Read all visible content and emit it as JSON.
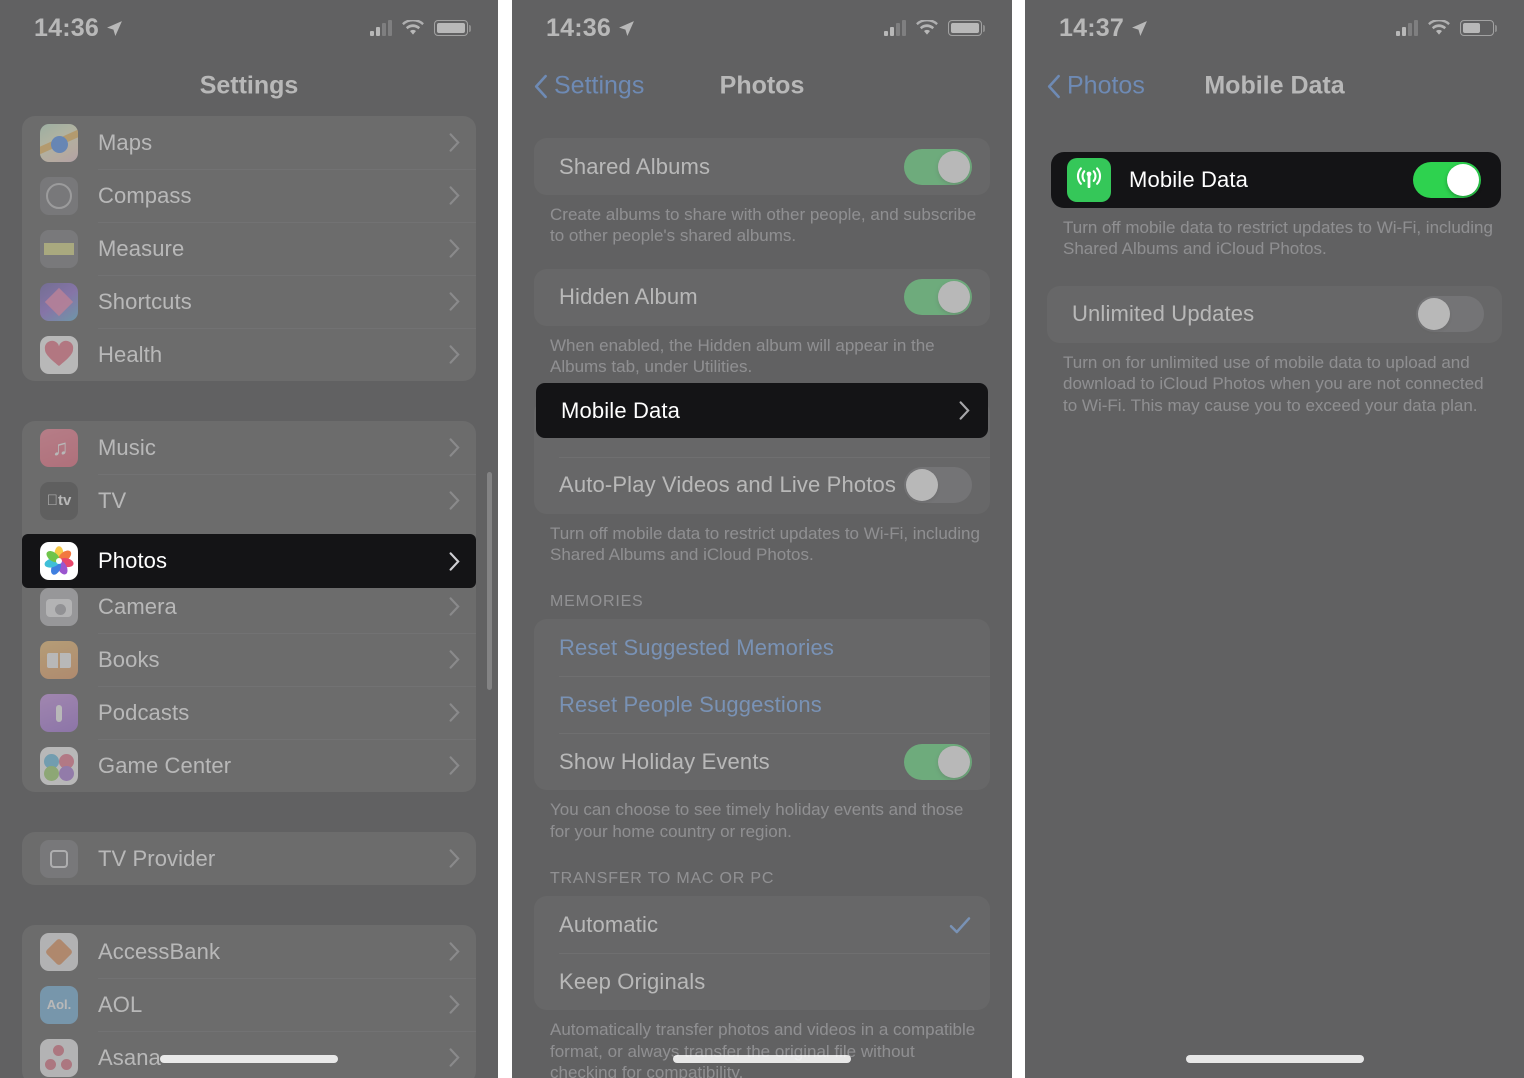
{
  "panels": [
    {
      "id": "settings-list",
      "status_bar": {
        "time": "14:36",
        "location_icon": "location-arrow-icon",
        "signal_icon": "cellular-bars-icon",
        "wifi_icon": "wifi-icon",
        "battery_icon": "battery-icon"
      },
      "nav": {
        "title": "Settings",
        "back_label": "",
        "has_back": false
      },
      "groups": [
        {
          "rows": [
            {
              "label": "Maps",
              "icon": "maps-app-icon",
              "chevron": true
            },
            {
              "label": "Compass",
              "icon": "compass-app-icon",
              "chevron": true
            },
            {
              "label": "Measure",
              "icon": "measure-app-icon",
              "chevron": true
            },
            {
              "label": "Shortcuts",
              "icon": "shortcuts-app-icon",
              "chevron": true
            },
            {
              "label": "Health",
              "icon": "health-app-icon",
              "chevron": true
            }
          ]
        },
        {
          "rows": [
            {
              "label": "Music",
              "icon": "music-app-icon",
              "chevron": true
            },
            {
              "label": "TV",
              "icon": "tv-app-icon",
              "chevron": true
            },
            {
              "label": "Photos",
              "icon": "photos-app-icon",
              "chevron": true,
              "highlighted": true
            },
            {
              "label": "Camera",
              "icon": "camera-app-icon",
              "chevron": true
            },
            {
              "label": "Books",
              "icon": "books-app-icon",
              "chevron": true
            },
            {
              "label": "Podcasts",
              "icon": "podcasts-app-icon",
              "chevron": true
            },
            {
              "label": "Game Center",
              "icon": "game-center-app-icon",
              "chevron": true
            }
          ]
        },
        {
          "rows": [
            {
              "label": "TV Provider",
              "icon": "tv-provider-icon",
              "chevron": true
            }
          ]
        },
        {
          "rows": [
            {
              "label": "AccessBank",
              "icon": "accessbank-app-icon",
              "chevron": true
            },
            {
              "label": "AOL",
              "icon": "aol-app-icon",
              "chevron": true
            },
            {
              "label": "Asana",
              "icon": "asana-app-icon",
              "chevron": true
            }
          ]
        }
      ]
    },
    {
      "id": "photos-settings",
      "status_bar": {
        "time": "14:36",
        "location_icon": "location-arrow-icon",
        "signal_icon": "cellular-bars-icon",
        "wifi_icon": "wifi-icon",
        "battery_icon": "battery-icon"
      },
      "nav": {
        "title": "Photos",
        "back_label": "Settings",
        "has_back": true
      },
      "sections": [
        {
          "header": "",
          "rows": [
            {
              "label": "Shared Albums",
              "control": "toggle",
              "value": "on"
            }
          ],
          "footnote": "Create albums to share with other people, and subscribe to other people's shared albums."
        },
        {
          "header": "",
          "rows": [
            {
              "label": "Hidden Album",
              "control": "toggle",
              "value": "on"
            }
          ],
          "footnote": "When enabled, the Hidden album will appear in the Albums tab, under Utilities."
        },
        {
          "header": "",
          "rows": [
            {
              "label": "Mobile Data",
              "control": "chevron",
              "highlighted": true
            },
            {
              "label": "Auto-Play Videos and Live Photos",
              "control": "toggle",
              "value": "off"
            }
          ],
          "footnote": "Turn off mobile data to restrict updates to Wi-Fi, including Shared Albums and iCloud Photos."
        },
        {
          "header": "MEMORIES",
          "rows": [
            {
              "label": "Reset Suggested Memories",
              "control": "link"
            },
            {
              "label": "Reset People Suggestions",
              "control": "link"
            },
            {
              "label": "Show Holiday Events",
              "control": "toggle",
              "value": "on"
            }
          ],
          "footnote": "You can choose to see timely holiday events and those for your home country or region."
        },
        {
          "header": "TRANSFER TO MAC OR PC",
          "rows": [
            {
              "label": "Automatic",
              "control": "checkmark",
              "value": "selected"
            },
            {
              "label": "Keep Originals",
              "control": "none"
            }
          ],
          "footnote": "Automatically transfer photos and videos in a compatible format, or always transfer the original file without checking for compatibility."
        }
      ]
    },
    {
      "id": "mobile-data-settings",
      "status_bar": {
        "time": "14:37",
        "location_icon": "location-arrow-icon",
        "signal_icon": "cellular-bars-icon",
        "wifi_icon": "wifi-icon",
        "battery_icon": "battery-icon"
      },
      "nav": {
        "title": "Mobile Data",
        "back_label": "Photos",
        "has_back": true
      },
      "sections": [
        {
          "header": "",
          "rows": [
            {
              "label": "Mobile Data",
              "icon": "cellular-signal-icon",
              "control": "toggle",
              "value": "on",
              "highlighted": true
            }
          ],
          "footnote": "Turn off mobile data to restrict updates to Wi-Fi, including Shared Albums and iCloud Photos."
        },
        {
          "header": "",
          "rows": [
            {
              "label": "Unlimited Updates",
              "control": "toggle",
              "value": "off"
            }
          ],
          "footnote": "Turn on for unlimited use of mobile data to upload and download to iCloud Photos when you are not connected to Wi-Fi. This may cause you to exceed your data plan."
        }
      ]
    }
  ],
  "colors": {
    "accent_blue": "#3e86f5",
    "toggle_on_green": "#3ddc62",
    "cell_icon_green": "#35c759",
    "group_bg": "#2c2c2e",
    "screen_bg": "#1c1c1e",
    "highlight_bg": "#141416"
  },
  "icons": {
    "chevron_right": "chevron-right-icon",
    "chevron_left": "chevron-left-icon",
    "checkmark": "checkmark-icon",
    "home_indicator": "home-indicator"
  }
}
